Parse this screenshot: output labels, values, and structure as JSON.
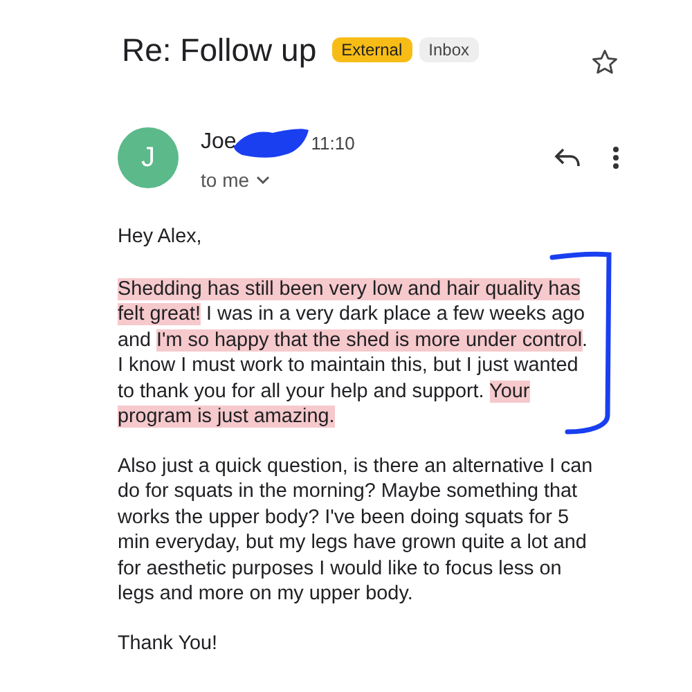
{
  "subject": "Re: Follow up",
  "labels": [
    {
      "text": "External",
      "kind": "external"
    },
    {
      "text": "Inbox",
      "kind": "inbox"
    }
  ],
  "starred": false,
  "sender": {
    "initial": "J",
    "name": "Joe",
    "time": "11:10",
    "recipient": "to me"
  },
  "greeting": "Hey Alex,",
  "paragraphs": [
    {
      "segments": [
        {
          "text": "Shedding has still been very low and hair quality has felt great!",
          "highlighted": true
        },
        {
          "text": " I was in a very dark place a few weeks ago and ",
          "highlighted": false
        },
        {
          "text": "I'm so happy that the shed is more under control",
          "highlighted": true
        },
        {
          "text": ". I know I must work to maintain this, but I just wanted to thank you for all your help and support. ",
          "highlighted": false
        },
        {
          "text": "Your program is just amazing.",
          "highlighted": true
        }
      ]
    },
    {
      "segments": [
        {
          "text": "Also just a quick question, is there an alternative I can do for squats in the morning? Maybe something that works the upper body? I've been doing squats for 5 min everyday, but my legs have grown quite a lot and for aesthetic purposes I would like to focus less on legs and more on my upper body.",
          "highlighted": false
        }
      ]
    }
  ],
  "signoff": "Thank You!"
}
